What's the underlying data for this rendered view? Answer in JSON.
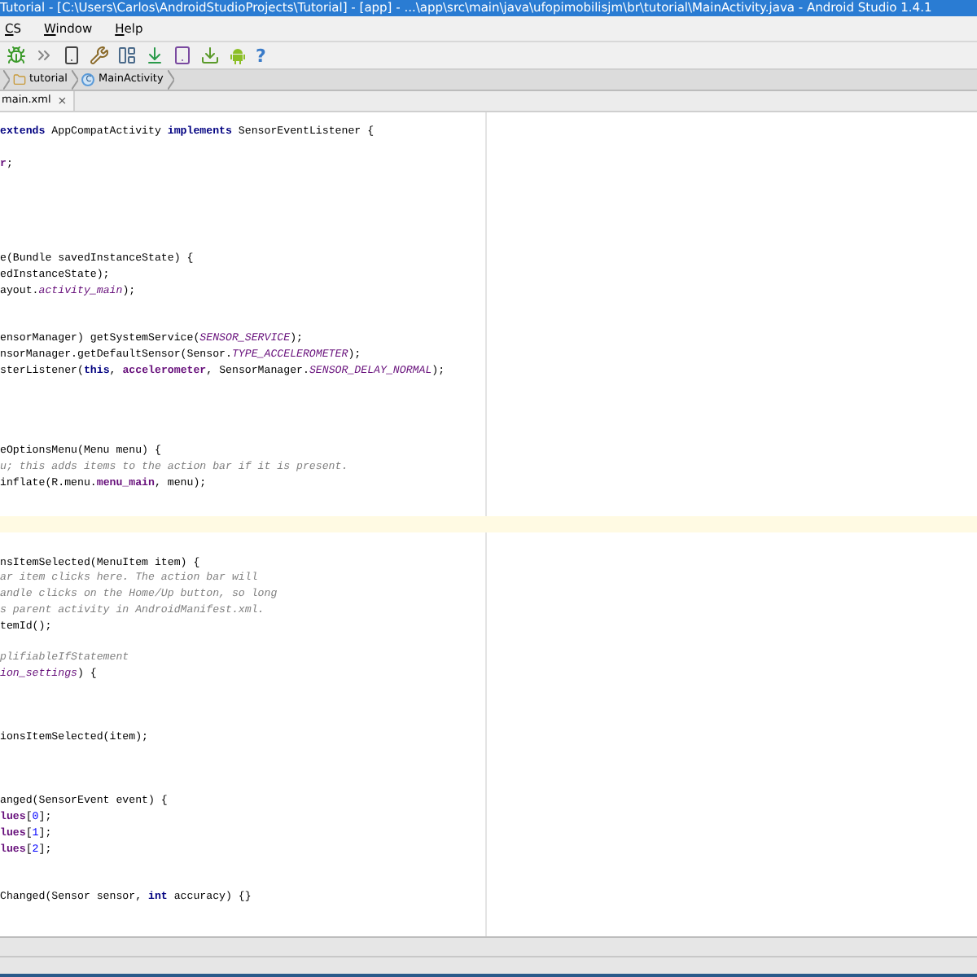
{
  "window": {
    "title": "Tutorial - [C:\\Users\\Carlos\\AndroidStudioProjects\\Tutorial] - [app] - ...\\app\\src\\main\\java\\ufopimobilisjm\\br\\tutorial\\MainActivity.java - Android Studio 1.4.1"
  },
  "menu": [
    "CS",
    "Window",
    "Help"
  ],
  "toolbar": [
    {
      "kind": "bug"
    },
    {
      "kind": "attach"
    },
    {
      "kind": "device"
    },
    {
      "kind": "wrench"
    },
    {
      "kind": "structure"
    },
    {
      "kind": "sync"
    },
    {
      "kind": "avd"
    },
    {
      "kind": "sdk"
    },
    {
      "kind": "android"
    },
    {
      "kind": "help",
      "text": "?"
    }
  ],
  "breadcrumbs": [
    {
      "kind": "folder",
      "label": "tutorial"
    },
    {
      "kind": "class",
      "label": "MainActivity",
      "icon_text": "C"
    }
  ],
  "tabs": [
    {
      "label": "main.xml",
      "close": "×"
    }
  ],
  "editor": {
    "lines": [
      {
        "current": false,
        "segments": [
          {
            "kind": "keyword",
            "text": "extends"
          },
          {
            "kind": "plain",
            "text": " AppCompatActivity "
          },
          {
            "kind": "keyword",
            "text": "implements"
          },
          {
            "kind": "plain",
            "text": " SensorEventListener {"
          }
        ]
      },
      {
        "current": false
      },
      {
        "current": false,
        "segments": [
          {
            "kind": "field",
            "text": "r"
          },
          {
            "kind": "plain",
            "text": ";"
          }
        ]
      },
      {
        "current": false
      },
      {
        "current": false
      },
      {
        "current": false
      },
      {
        "current": false
      },
      {
        "current": false
      },
      {
        "current": false,
        "segments": [
          {
            "kind": "plain",
            "text": "e(Bundle savedInstanceState) {"
          }
        ]
      },
      {
        "current": false,
        "segments": [
          {
            "kind": "plain",
            "text": "edInstanceState);"
          }
        ]
      },
      {
        "current": false,
        "segments": [
          {
            "kind": "plain",
            "text": "ayout."
          },
          {
            "kind": "static",
            "text": "activity_main"
          },
          {
            "kind": "plain",
            "text": ");"
          }
        ]
      },
      {
        "current": false
      },
      {
        "current": false
      },
      {
        "current": false,
        "segments": [
          {
            "kind": "plain",
            "text": "ensorManager) getSystemService("
          },
          {
            "kind": "static",
            "text": "SENSOR_SERVICE"
          },
          {
            "kind": "plain",
            "text": ");"
          }
        ]
      },
      {
        "current": false,
        "segments": [
          {
            "kind": "plain",
            "text": "nsorManager.getDefaultSensor(Sensor."
          },
          {
            "kind": "static",
            "text": "TYPE_ACCELEROMETER"
          },
          {
            "kind": "plain",
            "text": ");"
          }
        ]
      },
      {
        "current": false,
        "segments": [
          {
            "kind": "plain",
            "text": "sterListener("
          },
          {
            "kind": "keyword",
            "text": "this"
          },
          {
            "kind": "plain",
            "text": ", "
          },
          {
            "kind": "field",
            "text": "accelerometer"
          },
          {
            "kind": "plain",
            "text": ", SensorManager."
          },
          {
            "kind": "static",
            "text": "SENSOR_DELAY_NORMAL"
          },
          {
            "kind": "plain",
            "text": ");"
          }
        ]
      },
      {
        "current": false
      },
      {
        "current": false
      },
      {
        "current": false
      },
      {
        "current": false
      },
      {
        "current": false,
        "segments": [
          {
            "kind": "plain",
            "text": "eOptionsMenu(Menu menu) {"
          }
        ]
      },
      {
        "current": false,
        "segments": [
          {
            "kind": "comment",
            "text": "u; this adds items to the action bar if it is present."
          }
        ]
      },
      {
        "current": false,
        "segments": [
          {
            "kind": "plain",
            "text": "inflate(R.menu."
          },
          {
            "kind": "field",
            "text": "menu_main"
          },
          {
            "kind": "plain",
            "text": ", menu);"
          }
        ]
      },
      {
        "current": false
      },
      {
        "current": false
      },
      {
        "current": true
      },
      {
        "current": false
      },
      {
        "current": false,
        "segments": [
          {
            "kind": "plain",
            "text": "nsItemSelected(MenuItem item) {"
          }
        ]
      },
      {
        "current": false,
        "segments": [
          {
            "kind": "comment",
            "text": "ar item clicks here. The action bar will"
          }
        ]
      },
      {
        "current": false,
        "segments": [
          {
            "kind": "comment",
            "text": "andle clicks on the Home/Up button, so long"
          }
        ]
      },
      {
        "current": false,
        "segments": [
          {
            "kind": "comment",
            "text": "s parent activity in AndroidManifest.xml."
          }
        ]
      },
      {
        "current": false,
        "segments": [
          {
            "kind": "plain",
            "text": "temId();"
          }
        ]
      },
      {
        "current": false
      },
      {
        "current": false,
        "segments": [
          {
            "kind": "comment",
            "text": "plifiableIfStatement"
          }
        ]
      },
      {
        "current": false,
        "segments": [
          {
            "kind": "static",
            "text": "ion_settings"
          },
          {
            "kind": "plain",
            "text": ") {"
          }
        ]
      },
      {
        "current": false
      },
      {
        "current": false
      },
      {
        "current": false
      },
      {
        "current": false,
        "segments": [
          {
            "kind": "plain",
            "text": "ionsItemSelected(item);"
          }
        ]
      },
      {
        "current": false
      },
      {
        "current": false
      },
      {
        "current": false
      },
      {
        "current": false,
        "segments": [
          {
            "kind": "plain",
            "text": "anged(SensorEvent event) {"
          }
        ]
      },
      {
        "current": false,
        "segments": [
          {
            "kind": "field",
            "text": "lues"
          },
          {
            "kind": "plain",
            "text": "["
          },
          {
            "kind": "number",
            "text": "0"
          },
          {
            "kind": "plain",
            "text": "];"
          }
        ]
      },
      {
        "current": false,
        "segments": [
          {
            "kind": "field",
            "text": "lues"
          },
          {
            "kind": "plain",
            "text": "["
          },
          {
            "kind": "number",
            "text": "1"
          },
          {
            "kind": "plain",
            "text": "];"
          }
        ]
      },
      {
        "current": false,
        "segments": [
          {
            "kind": "field",
            "text": "lues"
          },
          {
            "kind": "plain",
            "text": "["
          },
          {
            "kind": "number",
            "text": "2"
          },
          {
            "kind": "plain",
            "text": "];"
          }
        ]
      },
      {
        "current": false
      },
      {
        "current": false
      },
      {
        "current": false,
        "segments": [
          {
            "kind": "plain",
            "text": "Changed(Sensor sensor, "
          },
          {
            "kind": "keyword",
            "text": "int"
          },
          {
            "kind": "plain",
            "text": " accuracy) {}"
          }
        ]
      }
    ]
  }
}
